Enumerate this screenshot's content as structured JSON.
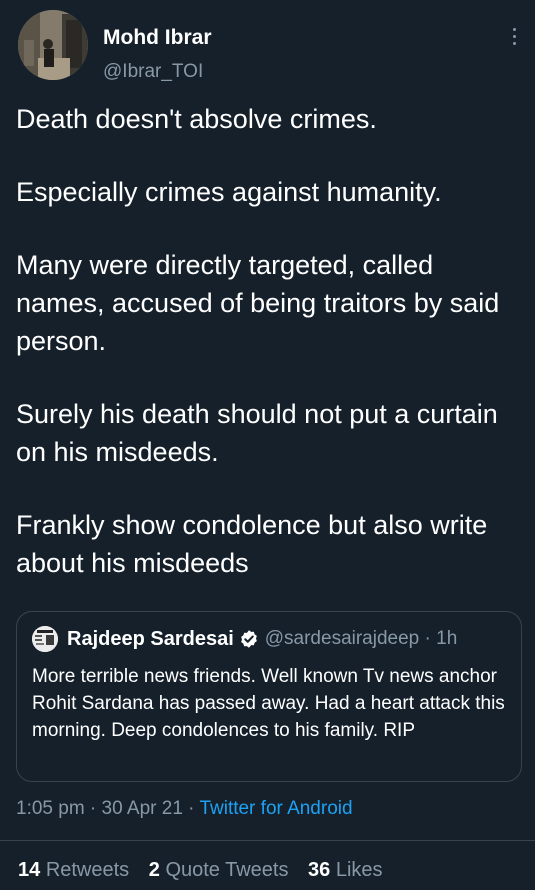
{
  "author": {
    "display_name": "Mohd Ibrar",
    "handle": "@Ibrar_TOI"
  },
  "tweet": {
    "paragraphs": [
      "Death doesn't absolve crimes.",
      "Especially crimes against humanity.",
      "Many were directly targeted, called names, accused of being traitors by said person.",
      "Surely his death should not put a curtain on his misdeeds.",
      "Frankly show condolence but also write about his misdeeds"
    ]
  },
  "quote_tweet": {
    "display_name": "Rajdeep Sardesai",
    "verified": true,
    "handle_time": "@sardesairajdeep · 1h",
    "text": "More terrible news friends. Well known Tv news anchor Rohit Sardana has passed away. Had a heart attack this morning. Deep condolences to his family. RIP"
  },
  "meta": {
    "time_date": "1:05 pm · 30 Apr 21 · ",
    "source": "Twitter for Android"
  },
  "stats": {
    "retweets_count": "14",
    "retweets_label": "Retweets",
    "quotes_count": "2",
    "quotes_label": "Quote Tweets",
    "likes_count": "36",
    "likes_label": "Likes"
  },
  "colors": {
    "background": "#15202b",
    "secondary_text": "#8899a6",
    "link": "#1da1f2",
    "border": "#38444d"
  }
}
